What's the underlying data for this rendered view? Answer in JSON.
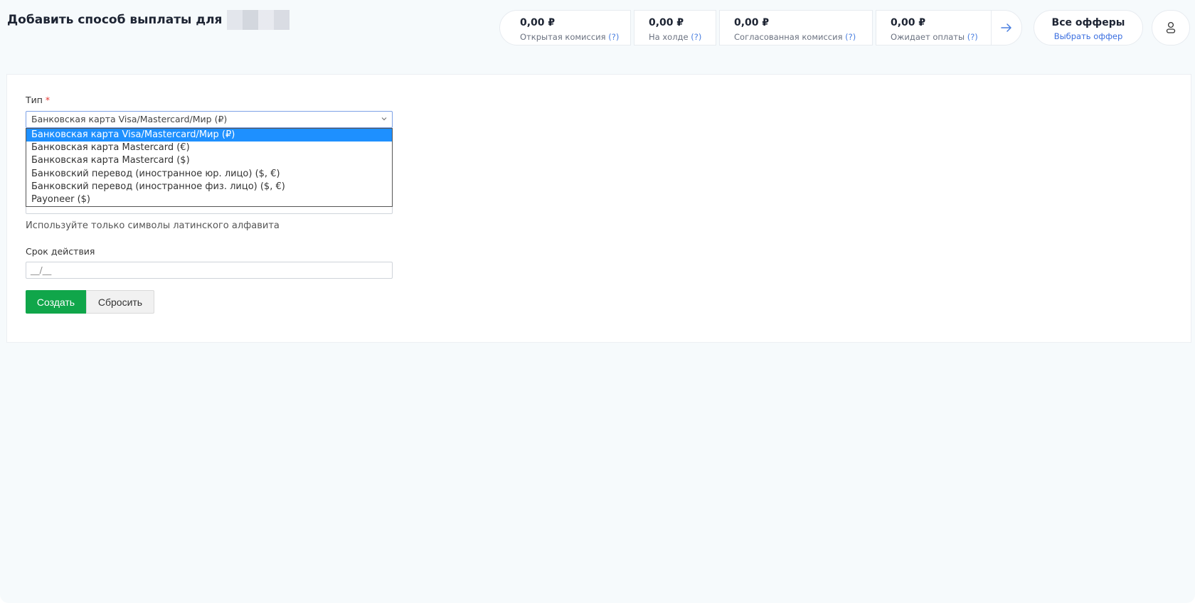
{
  "header": {
    "title": "Добавить способ выплаты для"
  },
  "stats": [
    {
      "value": "0,00 ₽",
      "label": "Открытая комиссия",
      "hint": "(?)"
    },
    {
      "value": "0,00 ₽",
      "label": "На холде",
      "hint": "(?)"
    },
    {
      "value": "0,00 ₽",
      "label": "Согласованная комиссия",
      "hint": "(?)"
    },
    {
      "value": "0,00 ₽",
      "label": "Ожидает оплаты",
      "hint": "(?)"
    }
  ],
  "offers": {
    "title": "Все офферы",
    "link": "Выбрать оффер"
  },
  "icons": {
    "arrow": "arrow-right-icon",
    "user": "user-icon",
    "chevron": "chevron-down-icon"
  },
  "colors": {
    "accent_link": "#3b6fe0",
    "primary_button": "#10a64a",
    "dropdown_active": "#1e90ff",
    "required": "#e53935"
  },
  "form": {
    "type_label": "Тип",
    "required_mark": "*",
    "selected_type": "Банковская карта Visa/Mastercard/Мир (₽)",
    "options": [
      "Банковская карта Visa/Mastercard/Мир (₽)",
      "Банковская карта Mastercard (€)",
      "Банковская карта Mastercard ($)",
      "Банковский перевод (иностранное юр. лицо) ($, €)",
      "Банковский перевод (иностранное физ. лицо) ($, €)",
      "Payoneer ($)"
    ],
    "latin_help": "Используйте только символы латинского алфавита",
    "expiry_label": "Срок действия",
    "expiry_placeholder": "__/__",
    "create_button": "Создать",
    "reset_button": "Сбросить"
  }
}
